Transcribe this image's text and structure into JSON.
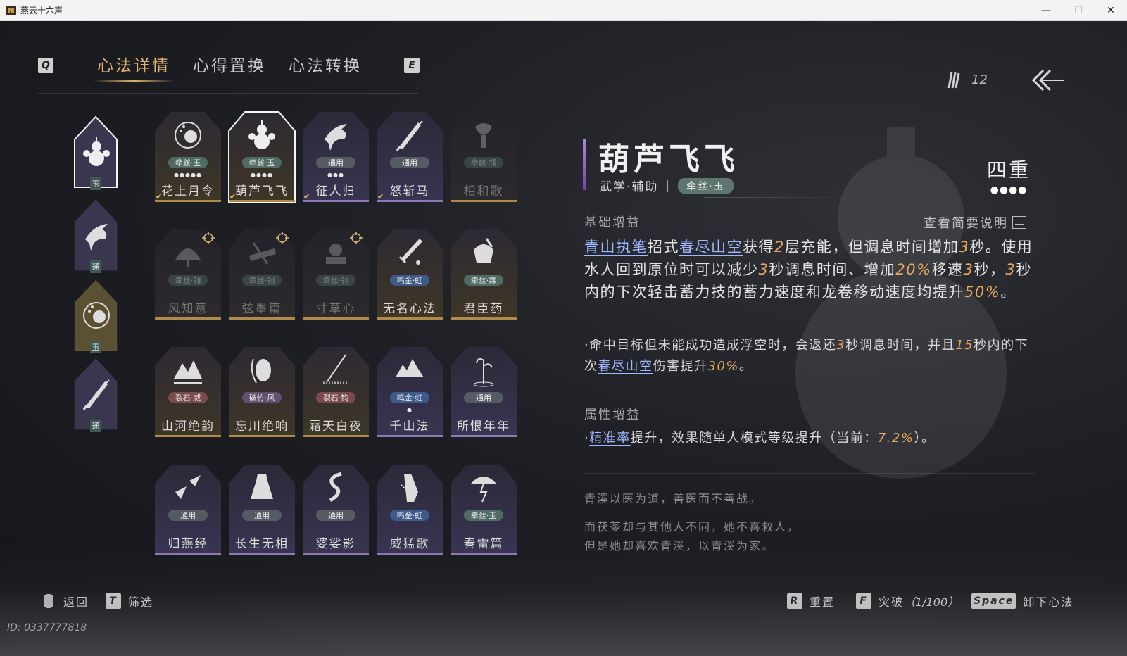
{
  "window": {
    "title": "燕云十六声",
    "controls": [
      "—",
      "☐",
      "✕"
    ]
  },
  "topnav": {
    "key_left": "Q",
    "key_right": "E",
    "tabs": [
      {
        "label": "心法详情",
        "active": true
      },
      {
        "label": "心得置换",
        "active": false
      },
      {
        "label": "心法转换",
        "active": false
      }
    ]
  },
  "currency": {
    "amount": "12",
    "icon": "feather-quills-icon"
  },
  "sidebar": {
    "slots": [
      {
        "tag": "玉",
        "icon": "gourd-icon",
        "selected": true
      },
      {
        "tag": "通",
        "icon": "crow-icon"
      },
      {
        "tag": "玉",
        "icon": "flower-moon-icon"
      },
      {
        "tag": "通",
        "icon": "broken-blade-icon"
      }
    ]
  },
  "cards": [
    {
      "name": "花上月令",
      "badge": "牵丝·玉",
      "badge_kind": "jade",
      "dots": "●●●●●",
      "icon": "flower-moon-icon",
      "frame": "gold",
      "equipped": true
    },
    {
      "name": "葫芦飞飞",
      "badge": "牵丝·玉",
      "badge_kind": "jade",
      "dots": "●●●●",
      "icon": "gourd-icon",
      "frame": "selected",
      "equipped": true
    },
    {
      "name": "征人归",
      "badge": "通用",
      "badge_kind": "gray",
      "dots": "●●●",
      "icon": "crow-icon",
      "frame": "purple",
      "equipped": true
    },
    {
      "name": "怒斩马",
      "badge": "通用",
      "badge_kind": "gray",
      "dots": "",
      "icon": "broken-blade-icon",
      "frame": "purple",
      "equipped": true
    },
    {
      "name": "相和歌",
      "badge": "牵丝·翎",
      "badge_kind": "jade",
      "dots": "",
      "icon": "lute-icon",
      "frame": "gold",
      "locked": true
    },
    {
      "name": "风知意",
      "badge": "牵丝·翎",
      "badge_kind": "jade",
      "dots": "",
      "icon": "fan-icon",
      "frame": "gold",
      "locked": true,
      "target": true
    },
    {
      "name": "弦墨篇",
      "badge": "牵丝·翎",
      "badge_kind": "jade",
      "dots": "",
      "icon": "zither-icon",
      "frame": "gold",
      "locked": true,
      "target": true
    },
    {
      "name": "寸草心",
      "badge": "牵丝·翎",
      "badge_kind": "jade",
      "dots": "",
      "icon": "scroll-fruit-icon",
      "frame": "gold",
      "locked": true,
      "target": true
    },
    {
      "name": "无名心法",
      "badge": "鸣金·虹",
      "badge_kind": "blue",
      "dots": "",
      "icon": "sword-icon",
      "frame": "gold"
    },
    {
      "name": "君臣药",
      "badge": "牵丝·霖",
      "badge_kind": "jade",
      "dots": "",
      "icon": "mortar-icon",
      "frame": "gold"
    },
    {
      "name": "山河绝韵",
      "badge": "裂石·威",
      "badge_kind": "red",
      "dots": "",
      "icon": "mountains-icon",
      "frame": "gold"
    },
    {
      "name": "忘川绝响",
      "badge": "破竹·风",
      "badge_kind": "purple",
      "dots": "",
      "icon": "ghost-face-icon",
      "frame": "gold"
    },
    {
      "name": "霜天白夜",
      "badge": "裂石·钧",
      "badge_kind": "red",
      "dots": "",
      "icon": "spear-icon",
      "frame": "gold"
    },
    {
      "name": "千山法",
      "badge": "鸣金·虹",
      "badge_kind": "blue",
      "dots": "●",
      "icon": "peaks-icon",
      "frame": "purple"
    },
    {
      "name": "所恨年年",
      "badge": "通用",
      "badge_kind": "gray",
      "dots": "",
      "icon": "reed-icon",
      "frame": "purple"
    },
    {
      "name": "归燕经",
      "badge": "通用",
      "badge_kind": "gray",
      "dots": "",
      "icon": "swallows-icon",
      "frame": "purple"
    },
    {
      "name": "长生无相",
      "badge": "通用",
      "badge_kind": "gray",
      "dots": "",
      "icon": "robe-icon",
      "frame": "purple"
    },
    {
      "name": "婆娑影",
      "badge": "通用",
      "badge_kind": "gray",
      "dots": "",
      "icon": "dragon-icon",
      "frame": "purple"
    },
    {
      "name": "威猛歌",
      "badge": "鸣金·虹",
      "badge_kind": "blue",
      "dots": "",
      "icon": "prayer-hand-icon",
      "frame": "purple"
    },
    {
      "name": "春雷篇",
      "badge": "牵丝·玉",
      "badge_kind": "jade",
      "dots": "",
      "icon": "storm-tree-icon",
      "frame": "purple"
    }
  ],
  "detail": {
    "title": "葫芦飞飞",
    "category": "武学·辅助",
    "category_sep": "|",
    "tag": "牵丝·玉",
    "tier_label": "四重",
    "tier_dots": "●●●●",
    "basic_header": "基础增益",
    "view_brief": "查看简要说明",
    "main": {
      "p1": "青山执笔",
      "p2": "招式",
      "p3": "春尽山空",
      "p4": "获得",
      "p5": "2",
      "p6": "层充能，但调息时间增加",
      "p7": "3",
      "p8": "秒。使用水人回到原位时可以减少",
      "p9": "3",
      "p10": "秒调息时间、增加",
      "p11": "20%",
      "p12": "移速",
      "p13": "3",
      "p14": "秒，",
      "p15": "3",
      "p16": "秒内的下次轻击蓄力技的蓄力速度和龙卷移动速度均提升",
      "p17": "50%",
      "p18": "。"
    },
    "extra": {
      "e1": "·命中目标但未能成功造成浮空时，会返还",
      "e2": "3",
      "e3": "秒调息时间，并且",
      "e4": "15",
      "e5": "秒内的下次",
      "e6": "春尽山空",
      "e7": "伤害提升",
      "e8": "30%",
      "e9": "。"
    },
    "attr_header": "属性增益",
    "attr": {
      "a1": "·",
      "a2": "精准率",
      "a3": "提升，效果随单人模式等级提升（当前：",
      "a4": "7.2%",
      "a5": "）。"
    },
    "lore": [
      "青溪以医为道，善医而不善战。",
      "而茯苓却与其他人不同，她不喜救人，",
      "但是她却喜欢青溪，以青溪为家。"
    ]
  },
  "bottombar": {
    "back": "返回",
    "filter_key": "T",
    "filter": "筛选",
    "reset_key": "R",
    "reset": "重置",
    "break_key": "F",
    "break": "突破",
    "break_count": "（1/100）",
    "unequip_key": "Space",
    "unequip": "卸下心法"
  },
  "id_text": "ID: 0337777818",
  "colors": {
    "accent_gold": "#e2b471",
    "link_blue": "#9fb8ff",
    "highlight_orange": "#e8a55d",
    "jade": "#4e6b64",
    "purple_frame": "#8b7ab8"
  }
}
